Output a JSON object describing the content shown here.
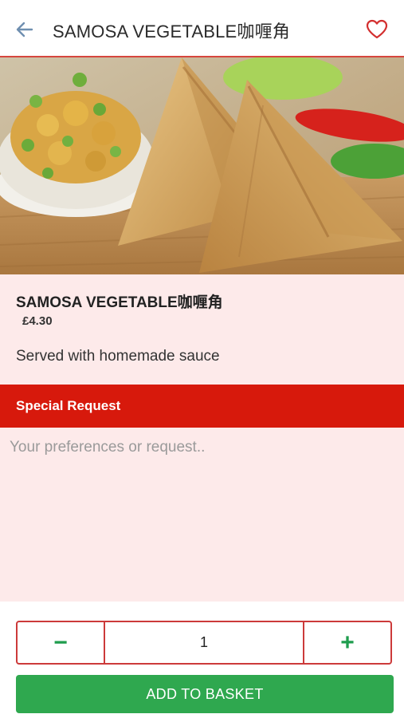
{
  "header": {
    "title": "SAMOSA VEGETABLE咖喱角",
    "back_icon": "back-arrow-icon",
    "favorite_icon": "heart-outline-icon"
  },
  "item": {
    "name": "SAMOSA VEGETABLE咖喱角",
    "price": "£4.30",
    "description": "Served with homemade sauce"
  },
  "special_request": {
    "title": "Special Request",
    "placeholder": "Your preferences or request..",
    "value": ""
  },
  "quantity": {
    "value": "1",
    "decrement_label": "−",
    "increment_label": "+"
  },
  "actions": {
    "add_to_basket": "ADD TO BASKET"
  },
  "colors": {
    "accent_red": "#d7190c",
    "border_red": "#cc3a3a",
    "green": "#2fa84f",
    "panel_pink": "#fdeaea"
  }
}
